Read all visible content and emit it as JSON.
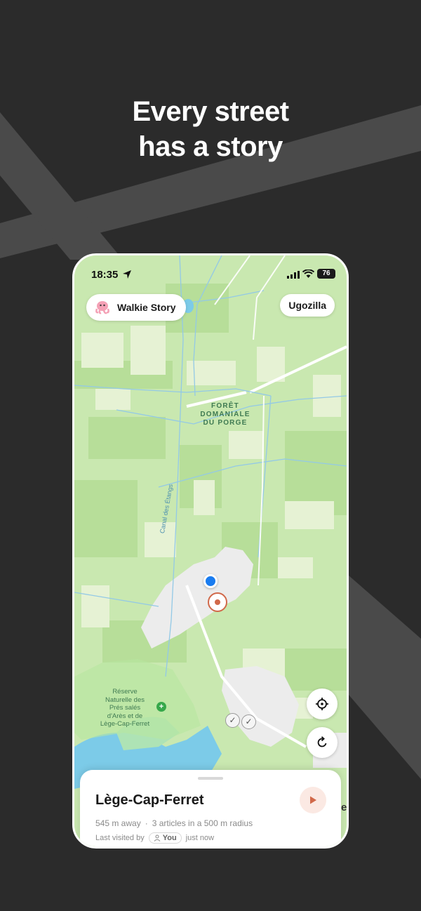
{
  "headline": {
    "line1": "Every street",
    "line2": "has a story"
  },
  "status_bar": {
    "time": "18:35",
    "battery": "76"
  },
  "app": {
    "brand_label": "Walkie Story",
    "user_label": "Ugozilla"
  },
  "map_labels": {
    "forest": [
      "FORÊT",
      "DOMANIALE",
      "DU PORGE"
    ],
    "canal": "Canal des Étangs",
    "reserve": [
      "Réserve",
      "Naturelle des",
      "Prés salés",
      "d'Arès et de",
      "Lège-Cap-Ferret"
    ]
  },
  "sheet": {
    "place": "Lège-Cap-Ferret",
    "distance": "545 m away",
    "separator": "·",
    "articles": "3 articles in a 500 m radius",
    "last_visited_label": "Last visited by",
    "visitor": "You",
    "visited_when": "just now"
  },
  "colors": {
    "background": "#2b2b2b",
    "map_green": "#c9e8b0",
    "water": "#7ccbe8",
    "accent": "#d1694a",
    "user_dot": "#1a7cf0"
  },
  "icons": [
    "location-arrow-icon",
    "signal-icon",
    "wifi-icon",
    "octopus-logo-icon",
    "reserve-plus-icon",
    "crosshair-icon",
    "refresh-icon",
    "play-icon",
    "user-icon",
    "check-icon"
  ]
}
